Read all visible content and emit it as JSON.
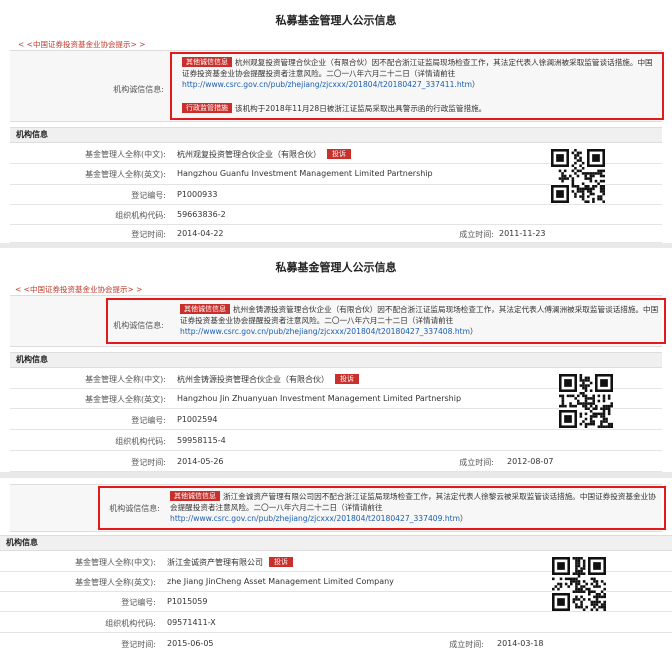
{
  "common": {
    "page_title": "私募基金管理人公示信息",
    "hint_link": "< <中国证券投资基金业协会提示> >",
    "credit_label": "机构诚信信息:",
    "section_title": "机构信息",
    "labels": {
      "name_cn": "基金管理人全称(中文):",
      "name_en": "基金管理人全称(英文):",
      "reg_no": "登记编号:",
      "org_code": "组织机构代码:",
      "reg_time": "登记时间:",
      "est_time": "成立时间:"
    },
    "complaint_label": "投诉",
    "tag_other": "其他诚信信息",
    "tag_admin": "行政监管措施",
    "colors": {
      "accent_red": "#c9302c",
      "box_red": "#e21a1a",
      "link_blue": "#1a5fb4"
    }
  },
  "panels": [
    {
      "credit_text_1": "杭州观复投资管理合伙企业（有限合伙）因不配合浙江证监局现场检查工作，其法定代表人徐澜洲被采取监管谈话措施。中国证券投资基金业协会提醒投资者注意风险。二〇一八年六月二十二日（详情请前往",
      "credit_url_1": "http://www.csrc.gov.cn/pub/zhejiang/zjcxxx/201804/t20180427_337411.htm",
      "credit_end_1": "）",
      "credit_text_2": "该机构于2018年11月28日被浙江证监局采取出具警示函的行政监管措施。",
      "name_cn": "杭州观复投资管理合伙企业（有限合伙）",
      "name_en": "Hangzhou Guanfu Investment Management Limited Partnership",
      "reg_no": "P1000933",
      "org_code": "59663836-2",
      "reg_time": "2014-04-22",
      "est_time": "2011-11-23"
    },
    {
      "credit_text_1": "杭州金铸源投资管理合伙企业（有限合伙）因不配合浙江证监局现场检查工作，其法定代表人傅澜洲被采取监管谈话措施。中国证券投资基金业协会提醒投资者注意风险。二〇一八年六月二十二日（详情请前往",
      "credit_url_1": "http://www.csrc.gov.cn/pub/zhejiang/zjcxxx/201804/t20180427_337408.htm",
      "credit_end_1": "）",
      "name_cn": "杭州金铸源投资管理合伙企业（有限合伙）",
      "name_en": "Hangzhou Jin Zhuanyuan Investment Management Limited Partnership",
      "reg_no": "P1002594",
      "org_code": "59958115-4",
      "reg_time": "2014-05-26",
      "est_time": "2012-08-07"
    },
    {
      "credit_text_1": "浙江金诚资产管理有限公司因不配合浙江证监局现场检查工作，其法定代表人徐黎云被采取监管谈话措施。中国证券投资基金业协会提醒投资者注意风险。二〇一八年六月二十二日（详情请前往",
      "credit_url_1": "http://www.csrc.gov.cn/pub/zhejiang/zjcxxx/201804/t20180427_337409.htm",
      "credit_end_1": "）",
      "name_cn": "浙江金诚资产管理有限公司",
      "name_en": "zhe Jiang JinCheng Asset Management Limited Company",
      "reg_no": "P1015059",
      "org_code": "09571411-X",
      "reg_time": "2015-06-05",
      "est_time": "2014-03-18"
    }
  ]
}
